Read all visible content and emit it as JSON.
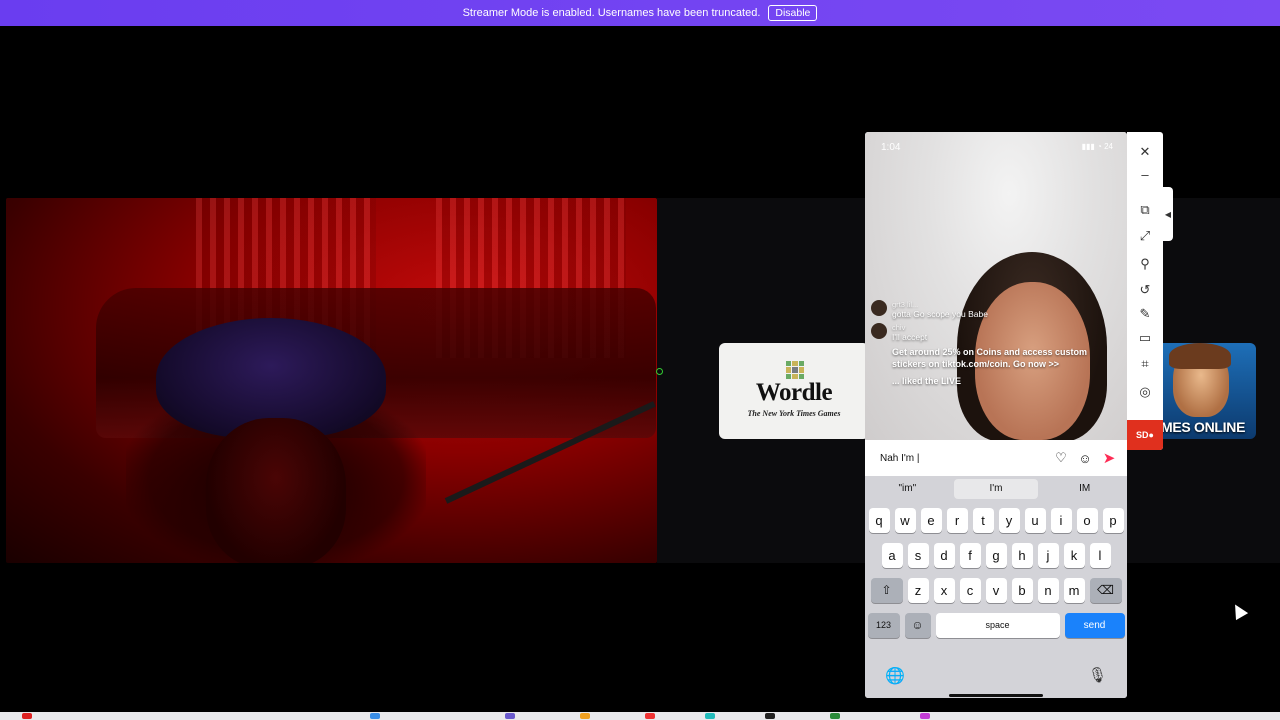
{
  "banner": {
    "message": "Streamer Mode is enabled. Usernames have been truncated.",
    "button_label": "Disable"
  },
  "wordle": {
    "title": "Wordle",
    "subtitle": "The New York Times Games"
  },
  "games_card": {
    "label": "MES ONLINE"
  },
  "phone": {
    "status_time": "1:04",
    "status_right": "▮▮▮ ◔ 24",
    "chat": [
      {
        "name": "grt3 lil...",
        "text": "gotta Go scope you Babe"
      },
      {
        "name": "chiv",
        "text": "I'll accept"
      }
    ],
    "promo": "Get around 25% on Coins and access custom stickers on tiktok.com/coin. Go now >>",
    "liked": "... liked the LIVE",
    "comment_value": "Nah I'm |",
    "keyboard": {
      "suggestions": [
        "\"im\"",
        "I'm",
        "IM"
      ],
      "row1": [
        "q",
        "w",
        "e",
        "r",
        "t",
        "y",
        "u",
        "i",
        "o",
        "p"
      ],
      "row2": [
        "a",
        "s",
        "d",
        "f",
        "g",
        "h",
        "j",
        "k",
        "l"
      ],
      "row3": [
        "z",
        "x",
        "c",
        "v",
        "b",
        "n",
        "m"
      ],
      "numbers_key": "123",
      "space_key": "space",
      "send_key": "send"
    }
  },
  "toolbar": {
    "record_label": "SD",
    "icons": [
      "close-icon",
      "minimize-icon",
      "screenshot-icon",
      "fullscreen-icon",
      "pin-icon",
      "rotate-icon",
      "pen-icon",
      "window-icon",
      "crop-icon",
      "settings-icon"
    ]
  },
  "colors": {
    "banner": "#7b4af3",
    "send_key": "#1a82fb",
    "record": "#e0301e",
    "tiktok_send": "#fe2c55"
  }
}
